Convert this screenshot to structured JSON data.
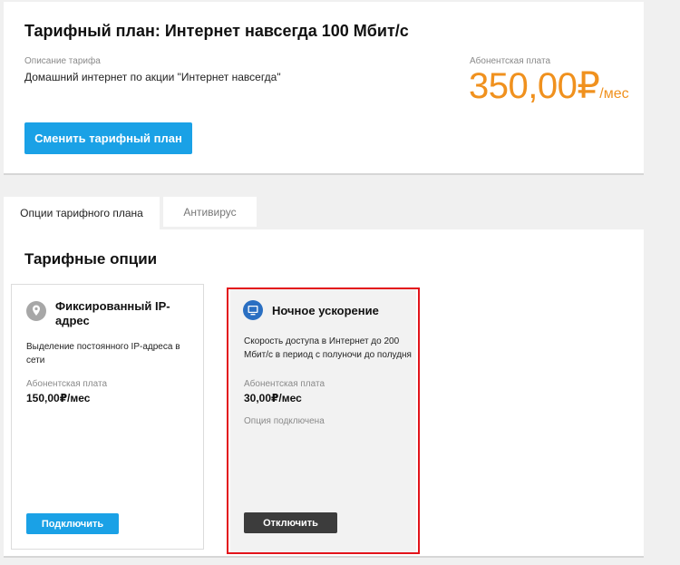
{
  "plan": {
    "title": "Тарифный план: Интернет навсегда 100 Мбит/с",
    "description_label": "Описание тарифа",
    "description": "Домашний интернет по акции \"Интернет навсегда\"",
    "fee_label": "Абонентская плата",
    "price_amount": "350,00₽",
    "price_unit": "/мес",
    "change_button": "Сменить тарифный план"
  },
  "tabs": [
    {
      "label": "Опции тарифного плана",
      "active": true
    },
    {
      "label": "Антивирус",
      "active": false
    }
  ],
  "options": {
    "title": "Тарифные опции",
    "items": [
      {
        "title_line1": "Фиксированный IP-",
        "title_line2": "адрес",
        "icon": "location-pin-icon",
        "desc_line1": "Выделение постоянного IP-адреса в",
        "desc_line2": "сети",
        "fee_label": "Абонентская плата",
        "price": "150,00₽/мес",
        "button": "Подключить"
      },
      {
        "title_line1": "Ночное ускорение",
        "icon": "monitor-icon",
        "desc_line1": "Скорость доступа в Интернет до 200",
        "desc_line2": "Мбит/с в период с полуночи до полудня",
        "fee_label": "Абонентская плата",
        "price": "30,00₽/мес",
        "status": "Опция подключена",
        "button": "Отключить"
      }
    ]
  },
  "colors": {
    "accent_orange": "#f0911e",
    "button_blue": "#1aa1e6",
    "highlight_red": "#e3141b",
    "button_dark": "#3c3c3c"
  }
}
